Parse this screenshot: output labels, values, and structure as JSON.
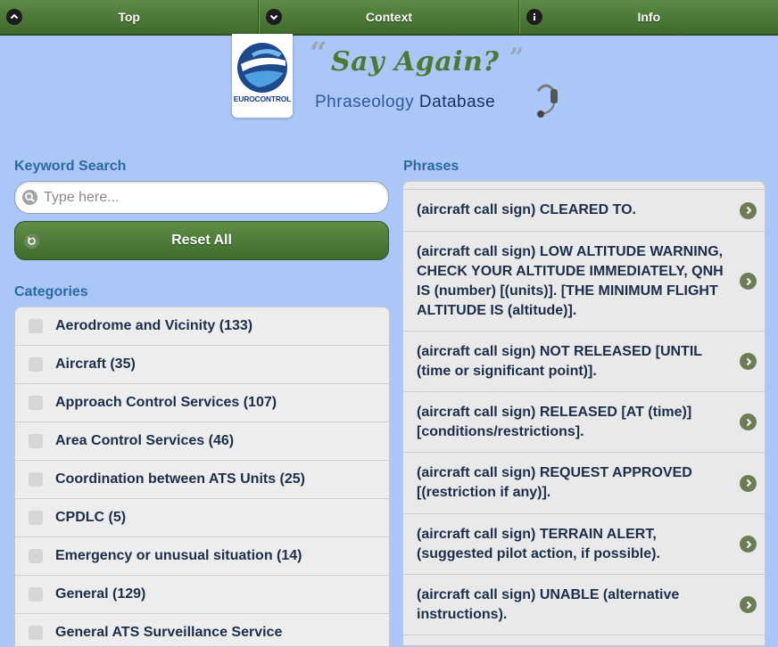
{
  "navbar": {
    "items": [
      {
        "label": "Top",
        "icon": "chevron-up-icon"
      },
      {
        "label": "Context",
        "icon": "chevron-down-icon"
      },
      {
        "label": "Info",
        "icon": "info-icon"
      }
    ]
  },
  "header": {
    "logo_text": "EUROCONTROL",
    "title": "Say Again?",
    "subtitle_part1": "Phraseology",
    "subtitle_part2": "Database"
  },
  "search": {
    "heading": "Keyword Search",
    "placeholder": "Type here...",
    "value": "",
    "reset_label": "Reset All"
  },
  "categories": {
    "heading": "Categories",
    "items": [
      {
        "label": "Aerodrome and Vicinity (133)",
        "checked": false
      },
      {
        "label": "Aircraft (35)",
        "checked": false
      },
      {
        "label": "Approach Control Services (107)",
        "checked": false
      },
      {
        "label": "Area Control Services (46)",
        "checked": false
      },
      {
        "label": "Coordination between ATS Units (25)",
        "checked": false
      },
      {
        "label": "CPDLC (5)",
        "checked": false
      },
      {
        "label": "Emergency or unusual situation (14)",
        "checked": false
      },
      {
        "label": "General (129)",
        "checked": false
      },
      {
        "label": "General ATS Surveillance Service",
        "checked": false
      }
    ]
  },
  "phrases": {
    "heading": "Phrases",
    "items": [
      {
        "text": "(aircraft call sign) CLEARED TO."
      },
      {
        "text": "(aircraft call sign) LOW ALTITUDE WARNING, CHECK YOUR ALTITUDE IMMEDIATELY, QNH IS (number) [(units)]. [THE MINIMUM FLIGHT ALTITUDE IS (altitude)]."
      },
      {
        "text": "(aircraft call sign) NOT RELEASED [UNTIL (time or significant point)]."
      },
      {
        "text": "(aircraft call sign) RELEASED [AT (time)] [conditions/restrictions]."
      },
      {
        "text": "(aircraft call sign) REQUEST APPROVED [(restriction if any)]."
      },
      {
        "text": "(aircraft call sign) TERRAIN ALERT, (suggested pilot action, if possible)."
      },
      {
        "text": "(aircraft call sign) UNABLE (alternative instructions)."
      }
    ]
  },
  "colors": {
    "background": "#aac7f7",
    "nav_green": "#4a7a33",
    "heading_blue": "#2a6aa0",
    "text_dark": "#1b2e4a"
  }
}
